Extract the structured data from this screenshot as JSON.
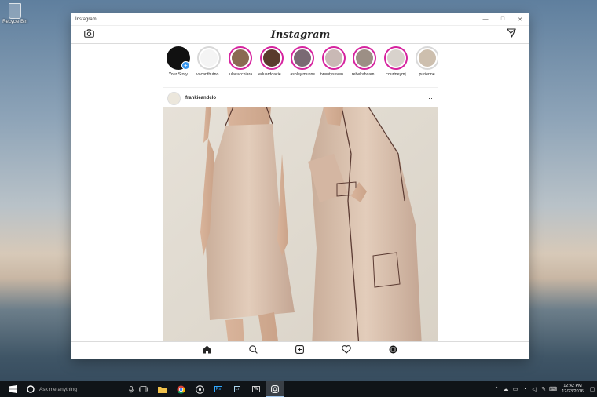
{
  "desktop": {
    "recycle_bin_label": "Recycle Bin"
  },
  "window": {
    "title": "Instagram",
    "minimize": "—",
    "maximize": "□",
    "close": "✕"
  },
  "app": {
    "logo": "Instagram",
    "stories": [
      {
        "name": "Your Story",
        "seen": false
      },
      {
        "name": "vacantbutno...",
        "seen": true
      },
      {
        "name": "lulacucchiara",
        "seen": false
      },
      {
        "name": "eduardoacie...",
        "seen": false
      },
      {
        "name": "ashley.munns",
        "seen": false
      },
      {
        "name": "twentyseven...",
        "seen": false
      },
      {
        "name": "rebekahcam...",
        "seen": false
      },
      {
        "name": "courtneymj",
        "seen": false
      },
      {
        "name": "purienne",
        "seen": true
      }
    ],
    "post": {
      "username": "frankieandclo",
      "more": "···"
    }
  },
  "taskbar": {
    "search_placeholder": "Ask me anything",
    "pinned": [
      "task-view",
      "file-explorer",
      "chrome",
      "obs",
      "photoshop",
      "lightroom",
      "word",
      "instagram"
    ],
    "pinned_labels": {
      "photoshop": "Ps",
      "lightroom": "Lr",
      "word": "W"
    },
    "time": "12:42 PM",
    "date": "12/23/2016"
  },
  "colors": {
    "story_ring": "#d6249f",
    "accent": "#3897f0",
    "taskbar": "#101418"
  }
}
